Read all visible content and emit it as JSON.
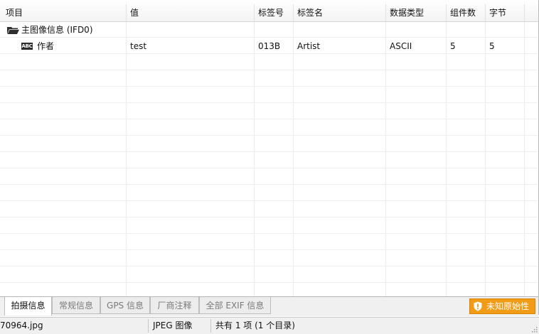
{
  "columns": [
    "项目",
    "值",
    "标签号",
    "标签名",
    "数据类型",
    "组件数",
    "字节"
  ],
  "group": {
    "label": "主图像信息 (IFD0)",
    "icon": "folder-icon"
  },
  "row": {
    "icon": "abc-text-icon",
    "icon_text": "ABC",
    "item": "作者",
    "value": "test",
    "tag_number": "013B",
    "tag_name": "Artist",
    "data_type": "ASCII",
    "components": "5",
    "bytes": "5"
  },
  "tabs": [
    {
      "label": "拍摄信息",
      "active": true
    },
    {
      "label": "常规信息",
      "active": false
    },
    {
      "label": "GPS 信息",
      "active": false
    },
    {
      "label": "厂商注释",
      "active": false
    },
    {
      "label": "全部 EXIF 信息",
      "active": false
    }
  ],
  "originality": {
    "label": "未知原始性",
    "color": "#f29b17",
    "icon": "shield-exclamation-icon"
  },
  "status": {
    "filename": "70964.jpg",
    "filetype": "JPEG 图像",
    "summary": "共有 1 项 (1 个目录)"
  }
}
